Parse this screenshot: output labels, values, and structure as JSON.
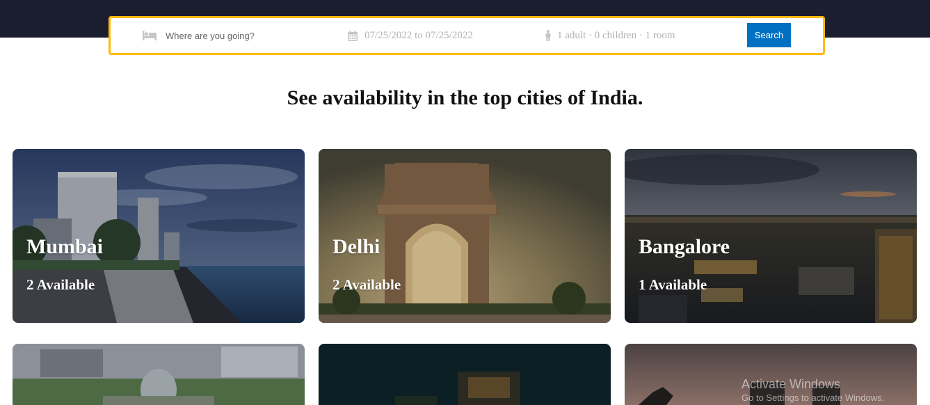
{
  "search": {
    "destination_placeholder": "Where are you going?",
    "dates": "07/25/2022 to 07/25/2022",
    "options": "1 adult · 0 children · 1 room",
    "button_label": "Search",
    "icons": [
      "bed-icon",
      "calendar-icon",
      "person-icon"
    ]
  },
  "heading": "See availability in the top cities of India.",
  "cities": [
    {
      "name": "Mumbai",
      "available": "2 Available"
    },
    {
      "name": "Delhi",
      "available": "2 Available"
    },
    {
      "name": "Bangalore",
      "available": "1 Available"
    }
  ],
  "watermark": {
    "title": "Activate Windows",
    "subtitle": "Go to Settings to activate Windows."
  },
  "colors": {
    "topbar": "#1b1e2e",
    "search_border": "#febb02",
    "search_button": "#0071c2"
  }
}
